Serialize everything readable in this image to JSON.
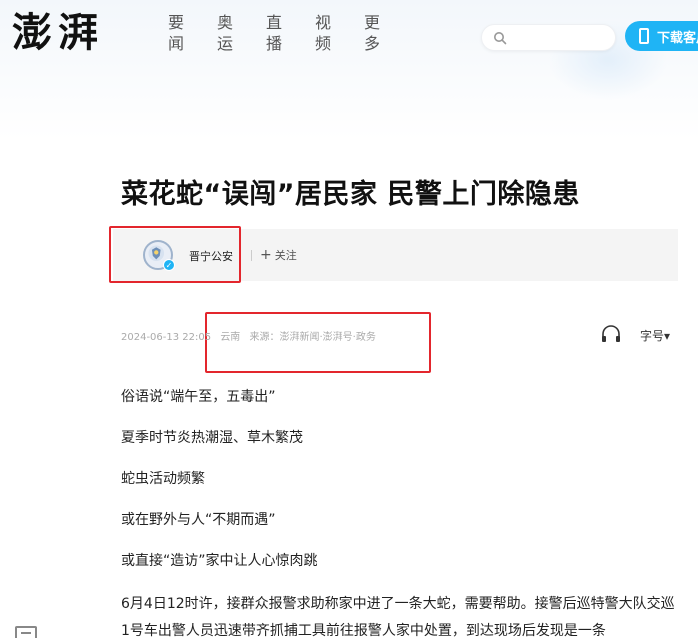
{
  "header": {
    "logo_text": "澎湃",
    "nav": [
      {
        "top": "要",
        "bottom": "闻"
      },
      {
        "top": "奥",
        "bottom": "运"
      },
      {
        "top": "直",
        "bottom": "播"
      },
      {
        "top": "视",
        "bottom": "频"
      },
      {
        "top": "更",
        "bottom": "多"
      }
    ],
    "search_placeholder": "",
    "download_label": "下载客户端"
  },
  "article": {
    "title": "菜花蛇“误闯”居民家 民警上门除隐患",
    "author": {
      "name": "晋宁公安",
      "follow_label": "关注"
    },
    "meta": {
      "datetime": "2024-06-13 22:05",
      "location": "云南",
      "source": "来源：澎湃新闻·澎湃号·政务"
    },
    "font_size_label": "字号▾",
    "paragraphs": [
      "俗语说“端午至，五毒出”",
      "夏季时节炎热潮湿、草木繁茂",
      "蛇虫活动频繁",
      "或在野外与人“不期而遇”",
      "或直接“造访”家中让人心惊肉跳",
      "6月4日12时许，接群众报警求助称家中进了一条大蛇，需要帮助。接警后巡特警大队交巡1号车出警人员迅速带齐抓捕工具前往报警人家中处置，到达现场后发现是一条"
    ]
  },
  "colors": {
    "accent": "#1fb4f5",
    "highlight_box": "#e3262d"
  }
}
